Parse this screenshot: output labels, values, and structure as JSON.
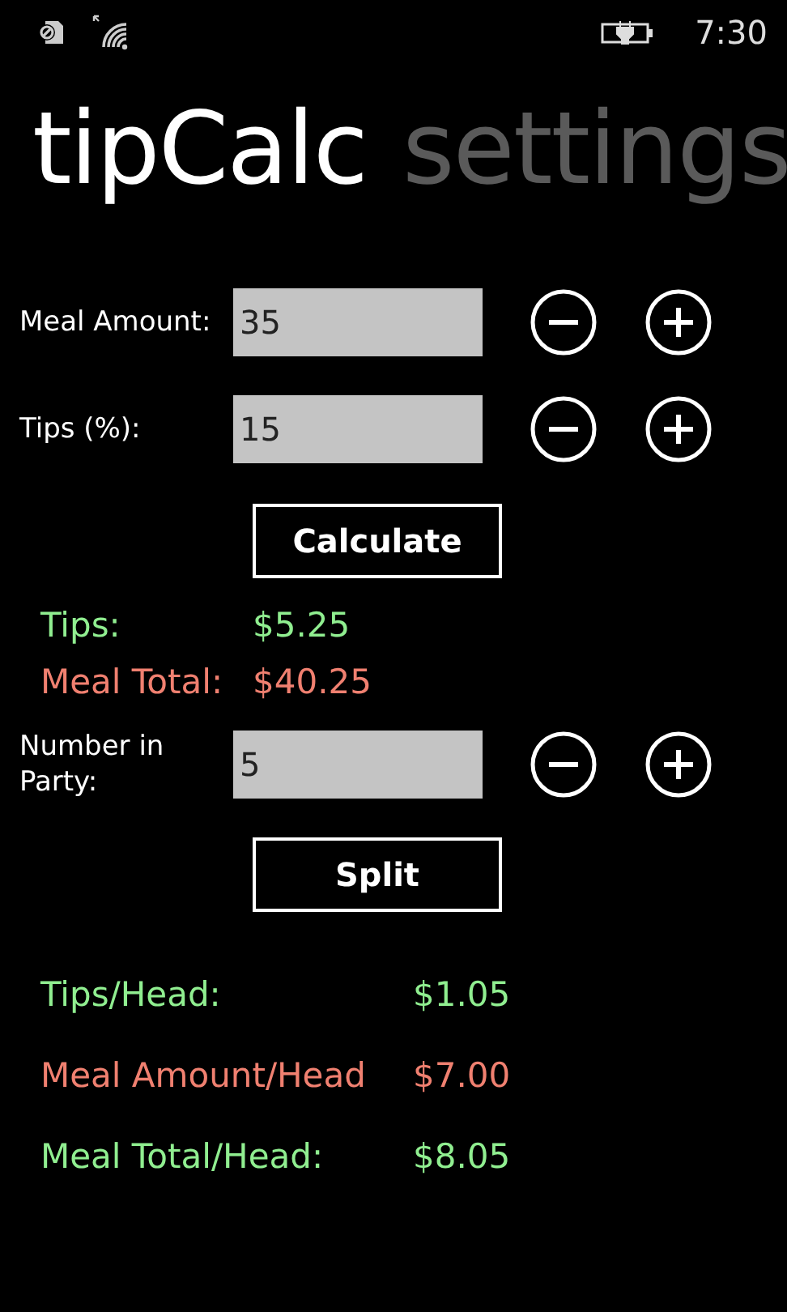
{
  "status_bar": {
    "time": "7:30"
  },
  "pivot": [
    {
      "label": "tipCalc",
      "selected": true
    },
    {
      "label": "settings",
      "selected": false
    }
  ],
  "inputs": [
    {
      "label": "Meal Amount:",
      "value": "35"
    },
    {
      "label": "Tips (%):",
      "value": "15"
    }
  ],
  "calculate_button": "Calculate",
  "totals": [
    {
      "label": "Tips:",
      "value": "$5.25",
      "color": "#90ee90"
    },
    {
      "label": "Meal Total:",
      "value": "$40.25",
      "color": "#f08070"
    }
  ],
  "party": {
    "label": "Number in Party:",
    "value": "5"
  },
  "split_button": "Split",
  "per_head": [
    {
      "label": "Tips/Head:",
      "value": "$1.05",
      "color": "#90ee90"
    },
    {
      "label": "Meal Amount/Head",
      "value": "$7.00",
      "color": "#f08070"
    },
    {
      "label": "Meal Total/Head:",
      "value": "$8.05",
      "color": "#90ee90"
    }
  ]
}
